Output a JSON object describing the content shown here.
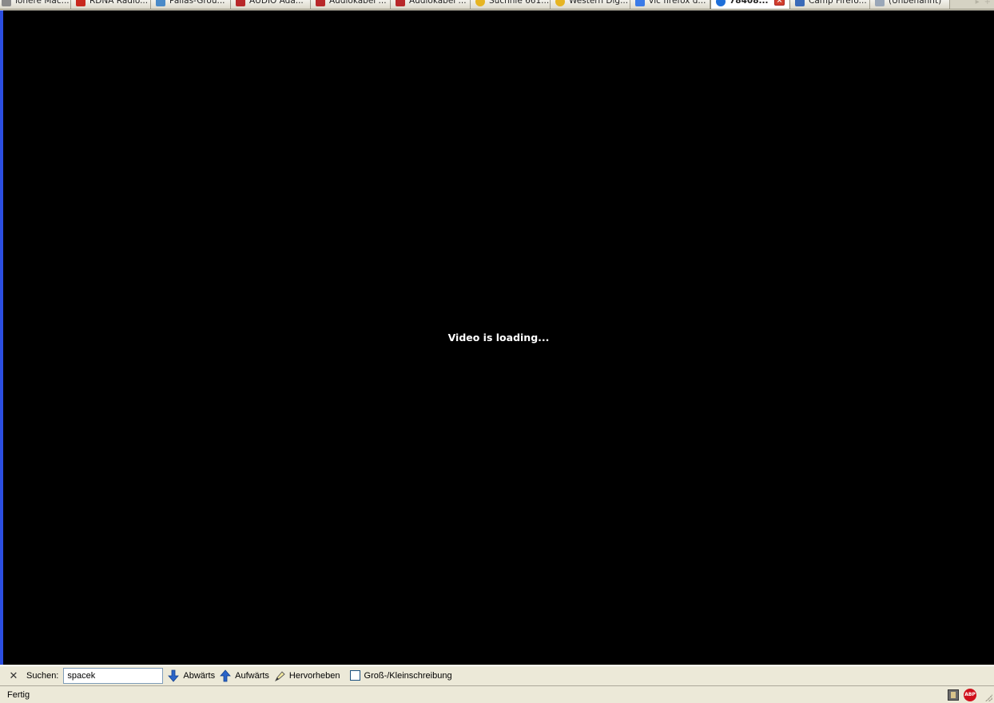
{
  "browser": {
    "tabs": [
      {
        "label": "lohere Mac...",
        "icon": "page-icon",
        "color": "#8a8a8a",
        "active": false
      },
      {
        "label": "RDNA Radio...",
        "icon": "radio-icon",
        "color": "#c8281e",
        "active": false
      },
      {
        "label": "Pallas-Grou...",
        "icon": "globe-icon",
        "color": "#4a8ac8",
        "active": false
      },
      {
        "label": "AUDIO Ada...",
        "icon": "shop-icon",
        "color": "#b8282a",
        "active": false
      },
      {
        "label": "Audiokabel ...",
        "icon": "shop-icon",
        "color": "#b8282a",
        "active": false
      },
      {
        "label": "Audiokabel ...",
        "icon": "shop-icon",
        "color": "#b8282a",
        "active": false
      },
      {
        "label": "Suchnie 661...",
        "icon": "smiley-icon",
        "color": "#e6b422",
        "active": false
      },
      {
        "label": "Western Dig...",
        "icon": "smiley-icon",
        "color": "#e6b422",
        "active": false
      },
      {
        "label": "vlc firefox d...",
        "icon": "google-icon",
        "color": "#3b7be8",
        "active": false
      },
      {
        "label": "78408...",
        "icon": "circle-icon",
        "color": "#1e6fd9",
        "active": true
      },
      {
        "label": "Camp Firefo...",
        "icon": "image-icon",
        "color": "#3a6ab8",
        "active": false
      },
      {
        "label": "(Unbenannt)",
        "icon": "blank-page-icon",
        "color": "#9aa7b8",
        "active": false
      }
    ],
    "tab_scroll_right": "▸",
    "tab_new": "+"
  },
  "content": {
    "video_message": "Video is loading...",
    "accent_border": "#2b4ee0"
  },
  "findbar": {
    "label": "Suchen:",
    "query": "spacek",
    "next_label": "Abwärts",
    "prev_label": "Aufwärts",
    "highlight_label": "Hervorheben",
    "match_case_label": "Groß-/Kleinschreibung",
    "match_case_checked": false
  },
  "statusbar": {
    "text": "Fertig",
    "abp_label": "ABP"
  }
}
